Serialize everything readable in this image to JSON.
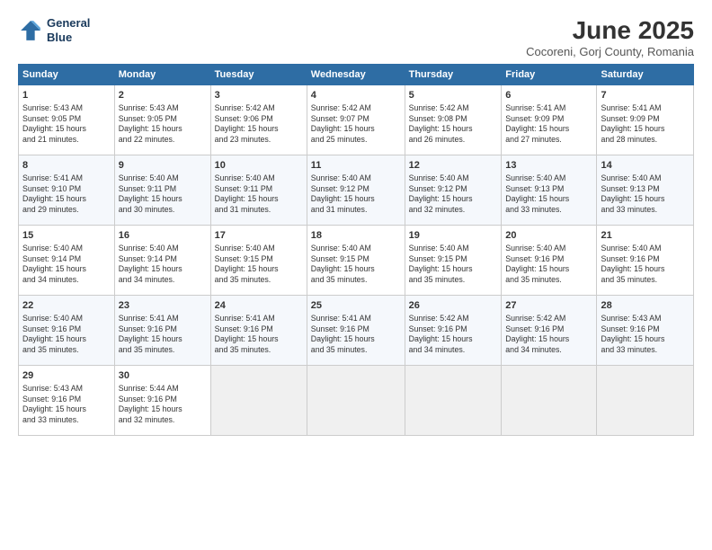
{
  "header": {
    "logo_line1": "General",
    "logo_line2": "Blue",
    "month_title": "June 2025",
    "location": "Cocoreni, Gorj County, Romania"
  },
  "columns": [
    "Sunday",
    "Monday",
    "Tuesday",
    "Wednesday",
    "Thursday",
    "Friday",
    "Saturday"
  ],
  "weeks": [
    [
      {
        "day": "1",
        "detail": "Sunrise: 5:43 AM\nSunset: 9:05 PM\nDaylight: 15 hours\nand 21 minutes."
      },
      {
        "day": "2",
        "detail": "Sunrise: 5:43 AM\nSunset: 9:05 PM\nDaylight: 15 hours\nand 22 minutes."
      },
      {
        "day": "3",
        "detail": "Sunrise: 5:42 AM\nSunset: 9:06 PM\nDaylight: 15 hours\nand 23 minutes."
      },
      {
        "day": "4",
        "detail": "Sunrise: 5:42 AM\nSunset: 9:07 PM\nDaylight: 15 hours\nand 25 minutes."
      },
      {
        "day": "5",
        "detail": "Sunrise: 5:42 AM\nSunset: 9:08 PM\nDaylight: 15 hours\nand 26 minutes."
      },
      {
        "day": "6",
        "detail": "Sunrise: 5:41 AM\nSunset: 9:09 PM\nDaylight: 15 hours\nand 27 minutes."
      },
      {
        "day": "7",
        "detail": "Sunrise: 5:41 AM\nSunset: 9:09 PM\nDaylight: 15 hours\nand 28 minutes."
      }
    ],
    [
      {
        "day": "8",
        "detail": "Sunrise: 5:41 AM\nSunset: 9:10 PM\nDaylight: 15 hours\nand 29 minutes."
      },
      {
        "day": "9",
        "detail": "Sunrise: 5:40 AM\nSunset: 9:11 PM\nDaylight: 15 hours\nand 30 minutes."
      },
      {
        "day": "10",
        "detail": "Sunrise: 5:40 AM\nSunset: 9:11 PM\nDaylight: 15 hours\nand 31 minutes."
      },
      {
        "day": "11",
        "detail": "Sunrise: 5:40 AM\nSunset: 9:12 PM\nDaylight: 15 hours\nand 31 minutes."
      },
      {
        "day": "12",
        "detail": "Sunrise: 5:40 AM\nSunset: 9:12 PM\nDaylight: 15 hours\nand 32 minutes."
      },
      {
        "day": "13",
        "detail": "Sunrise: 5:40 AM\nSunset: 9:13 PM\nDaylight: 15 hours\nand 33 minutes."
      },
      {
        "day": "14",
        "detail": "Sunrise: 5:40 AM\nSunset: 9:13 PM\nDaylight: 15 hours\nand 33 minutes."
      }
    ],
    [
      {
        "day": "15",
        "detail": "Sunrise: 5:40 AM\nSunset: 9:14 PM\nDaylight: 15 hours\nand 34 minutes."
      },
      {
        "day": "16",
        "detail": "Sunrise: 5:40 AM\nSunset: 9:14 PM\nDaylight: 15 hours\nand 34 minutes."
      },
      {
        "day": "17",
        "detail": "Sunrise: 5:40 AM\nSunset: 9:15 PM\nDaylight: 15 hours\nand 35 minutes."
      },
      {
        "day": "18",
        "detail": "Sunrise: 5:40 AM\nSunset: 9:15 PM\nDaylight: 15 hours\nand 35 minutes."
      },
      {
        "day": "19",
        "detail": "Sunrise: 5:40 AM\nSunset: 9:15 PM\nDaylight: 15 hours\nand 35 minutes."
      },
      {
        "day": "20",
        "detail": "Sunrise: 5:40 AM\nSunset: 9:16 PM\nDaylight: 15 hours\nand 35 minutes."
      },
      {
        "day": "21",
        "detail": "Sunrise: 5:40 AM\nSunset: 9:16 PM\nDaylight: 15 hours\nand 35 minutes."
      }
    ],
    [
      {
        "day": "22",
        "detail": "Sunrise: 5:40 AM\nSunset: 9:16 PM\nDaylight: 15 hours\nand 35 minutes."
      },
      {
        "day": "23",
        "detail": "Sunrise: 5:41 AM\nSunset: 9:16 PM\nDaylight: 15 hours\nand 35 minutes."
      },
      {
        "day": "24",
        "detail": "Sunrise: 5:41 AM\nSunset: 9:16 PM\nDaylight: 15 hours\nand 35 minutes."
      },
      {
        "day": "25",
        "detail": "Sunrise: 5:41 AM\nSunset: 9:16 PM\nDaylight: 15 hours\nand 35 minutes."
      },
      {
        "day": "26",
        "detail": "Sunrise: 5:42 AM\nSunset: 9:16 PM\nDaylight: 15 hours\nand 34 minutes."
      },
      {
        "day": "27",
        "detail": "Sunrise: 5:42 AM\nSunset: 9:16 PM\nDaylight: 15 hours\nand 34 minutes."
      },
      {
        "day": "28",
        "detail": "Sunrise: 5:43 AM\nSunset: 9:16 PM\nDaylight: 15 hours\nand 33 minutes."
      }
    ],
    [
      {
        "day": "29",
        "detail": "Sunrise: 5:43 AM\nSunset: 9:16 PM\nDaylight: 15 hours\nand 33 minutes."
      },
      {
        "day": "30",
        "detail": "Sunrise: 5:44 AM\nSunset: 9:16 PM\nDaylight: 15 hours\nand 32 minutes."
      },
      {
        "day": "",
        "detail": ""
      },
      {
        "day": "",
        "detail": ""
      },
      {
        "day": "",
        "detail": ""
      },
      {
        "day": "",
        "detail": ""
      },
      {
        "day": "",
        "detail": ""
      }
    ]
  ]
}
